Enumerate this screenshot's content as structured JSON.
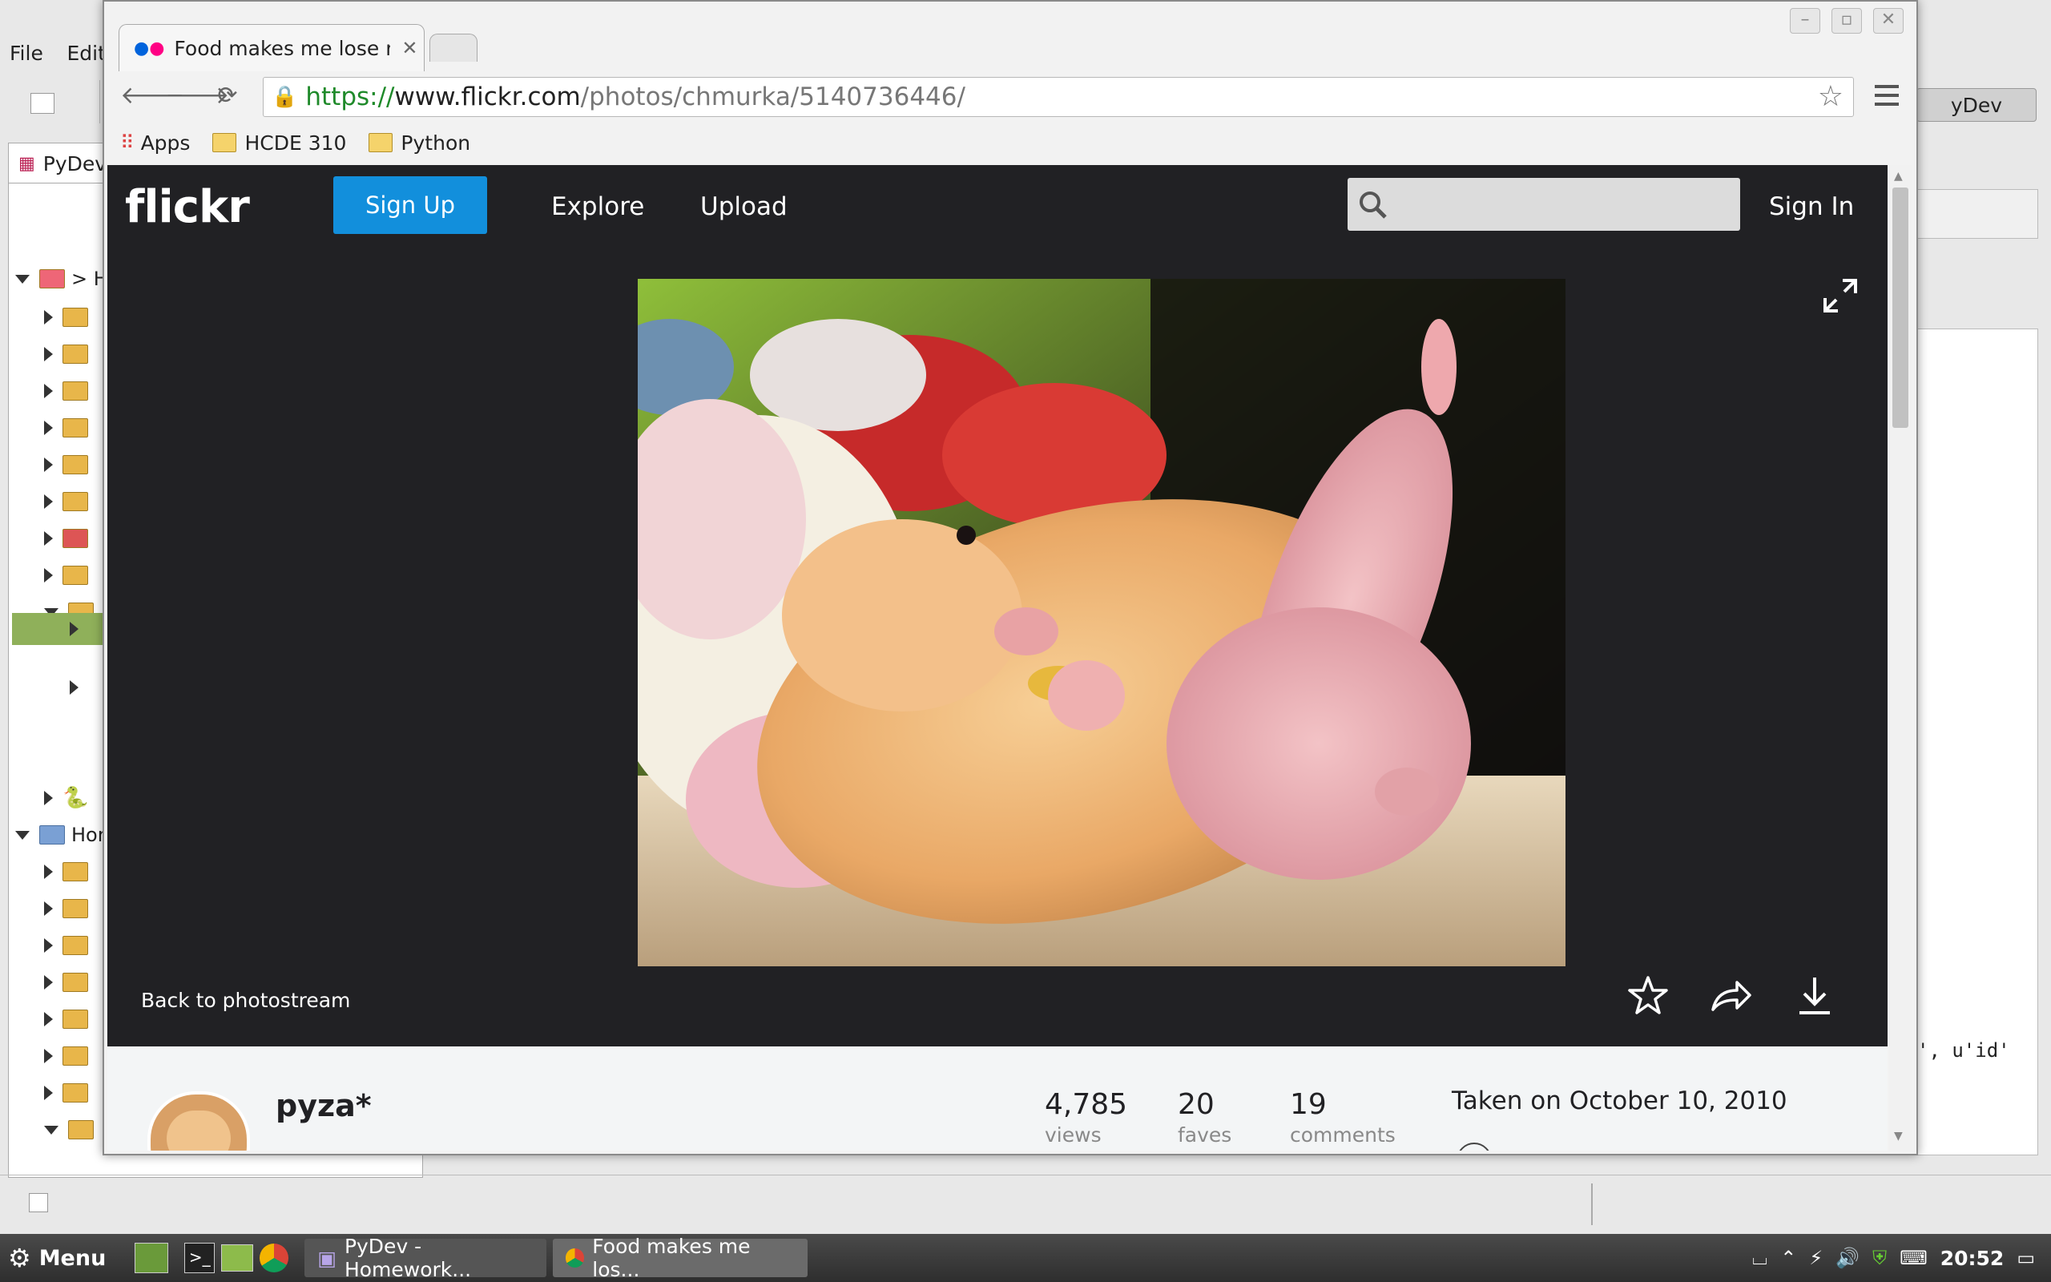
{
  "ide": {
    "menu": [
      "File",
      "Edit"
    ],
    "perspective_tab": "PyDev",
    "perspective_right": "yDev",
    "tree_fragment_top": "> H",
    "tree_fragment_home": "Hor",
    "code_fragment": "', u'id'"
  },
  "browser": {
    "tab_title": "Food makes me lose m",
    "url_scheme": "https://",
    "url_host": "www.flickr.com",
    "url_path": "/photos/chmurka/5140736446/",
    "bookmarks": [
      "Apps",
      "HCDE 310",
      "Python"
    ]
  },
  "flickr": {
    "logo": "flickr",
    "signup": "Sign Up",
    "explore": "Explore",
    "upload": "Upload",
    "signin": "Sign In",
    "back": "Back to photostream",
    "author": "pyza*",
    "views_num": "4,785",
    "views_lbl": "views",
    "faves_num": "20",
    "faves_lbl": "faves",
    "comments_num": "19",
    "comments_lbl": "comments",
    "taken": "Taken on October 10, 2010"
  },
  "taskbar": {
    "menu": "Menu",
    "win1": "PyDev - Homework...",
    "win2": "Food makes me los...",
    "clock": "20:52"
  }
}
